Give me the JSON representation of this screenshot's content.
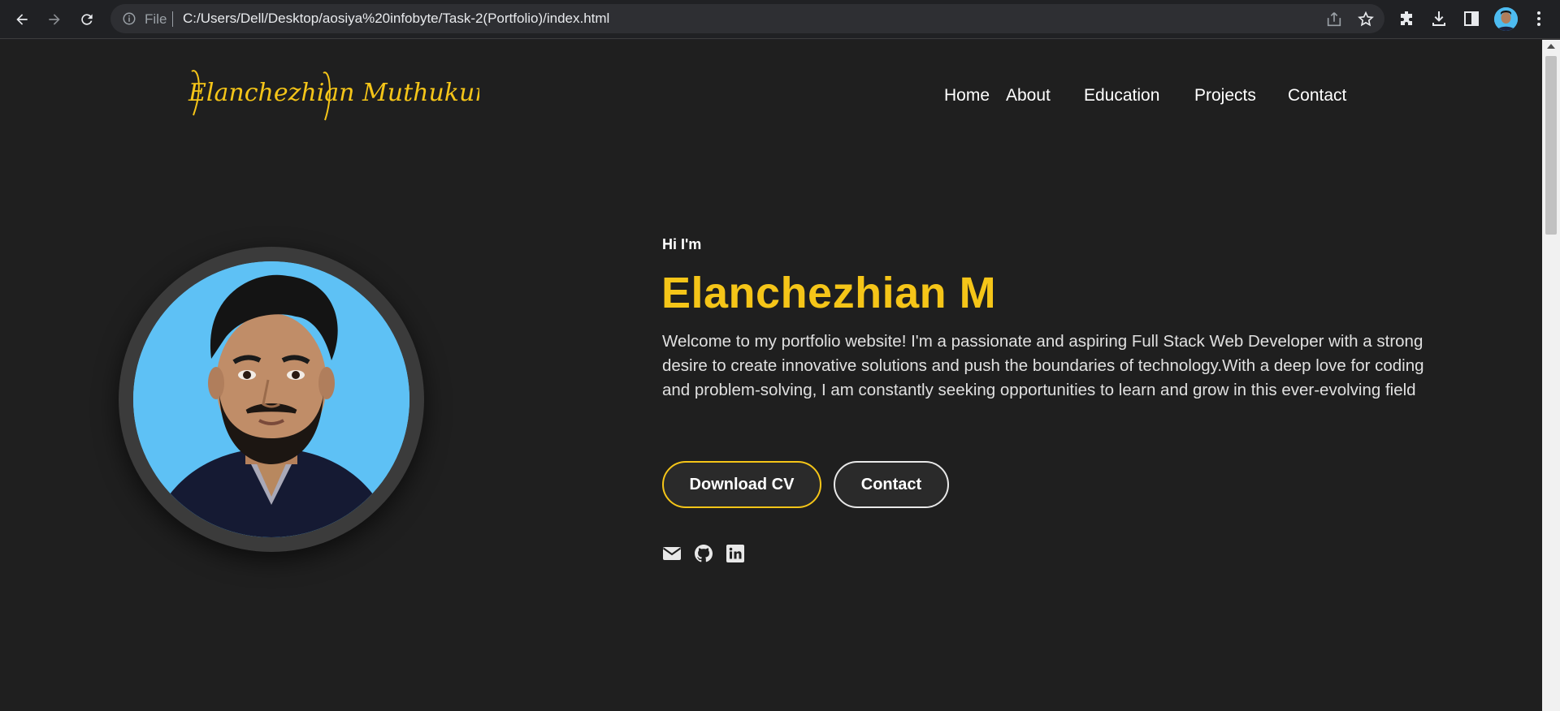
{
  "browser": {
    "file_label": "File",
    "url": "C:/Users/Dell/Desktop/aosiya%20infobyte/Task-2(Portfolio)/index.html"
  },
  "logo": {
    "text": "Elanchezhian Muthukumar",
    "color": "#f5c518"
  },
  "nav": {
    "items": [
      {
        "label": "Home"
      },
      {
        "label": "About"
      },
      {
        "label": "Education"
      },
      {
        "label": "Projects"
      },
      {
        "label": "Contact"
      }
    ]
  },
  "hero": {
    "greeting": "Hi I'm",
    "name": "Elanchezhian M",
    "intro": "Welcome to my portfolio website! I'm a passionate and aspiring Full Stack Web Developer with a strong desire to create innovative solutions and push the boundaries of technology.With a deep love for coding and problem-solving, I am constantly seeking opportunities to learn and grow in this ever-evolving field",
    "buttons": {
      "download_cv": "Download CV",
      "contact": "Contact"
    },
    "social": [
      "envelope-icon",
      "github-icon",
      "linkedin-icon"
    ]
  },
  "colors": {
    "accent": "#f5c518",
    "background": "#1f1f1f"
  }
}
